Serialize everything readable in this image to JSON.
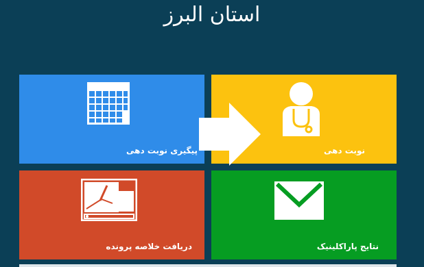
{
  "header": {
    "title": "استان البرز"
  },
  "tiles": [
    {
      "label": "پیگیری نوبت دهی",
      "color": "#2f8ce9",
      "icon": "calendar-icon"
    },
    {
      "label": "نوبت دهی",
      "color": "#fcc20f",
      "icon": "doctor-icon"
    },
    {
      "label": "دریافت خلاصه پرونده",
      "color": "#d14a29",
      "icon": "whiteboard-icon"
    },
    {
      "label": "نتایج پاراکلینیک",
      "color": "#069d22",
      "icon": "envelope-icon"
    }
  ],
  "overlay": {
    "icon": "arrow-right-icon"
  }
}
